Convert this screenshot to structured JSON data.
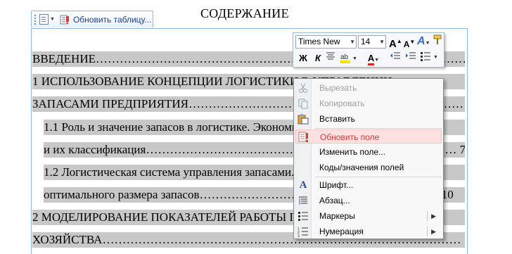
{
  "document": {
    "title": "СОДЕРЖАНИЕ",
    "update_table_label": "Обновить таблицу...",
    "toc_lines": [
      "ВВЕДЕНИЕ……………………………………………………………………………………. 6",
      "1 ИСПОЛЬЗОВАНИЕ КОНЦЕПЦИИ ЛОГИСТИКИ В УПРАВЛЕНИИ",
      "ЗАПАСАМИ ПРЕДПРИЯТИЯ……………………………………………………………… 7",
      "1.1 Роль и значение запасов в логистике. Экономическая сущность запасов",
      "и их классификация…………………………………………………………………… 7",
      "1.2 Логистическая система управления запасами. Определение",
      "оптимального размера запасов…………………………………………………… 10",
      "2 МОДЕЛИРОВАНИЕ ПОКАЗАТЕЛЕЙ РАБОТЫ ПРЕДПРИЯТИЯ",
      "ХОЗЯЙСТВА……………………………………………………………………………… 19"
    ]
  },
  "mini_toolbar": {
    "font_name": "Times New",
    "font_size": "14",
    "grow_font": "A",
    "shrink_font": "A",
    "bold": "Ж",
    "italic": "К",
    "font_color": "A",
    "style_letter": "A"
  },
  "context_menu": {
    "items": [
      {
        "label": "Вырезать",
        "icon": "scissors-icon",
        "disabled": true
      },
      {
        "label": "Копировать",
        "icon": "copy-icon",
        "disabled": true
      },
      {
        "label": "Вставить",
        "icon": "paste-icon",
        "disabled": false
      },
      {
        "label": "Обновить поле",
        "icon": "update-field-icon",
        "disabled": false,
        "hover": true
      },
      {
        "label": "Изменить поле...",
        "icon": "",
        "disabled": false
      },
      {
        "label": "Коды/значения полей",
        "icon": "",
        "disabled": false
      },
      {
        "label": "Шрифт...",
        "icon": "font-icon",
        "disabled": false
      },
      {
        "label": "Абзац...",
        "icon": "paragraph-icon",
        "disabled": false
      },
      {
        "label": "Маркеры",
        "icon": "bullets-icon",
        "disabled": false,
        "submenu": true
      },
      {
        "label": "Нумерация",
        "icon": "numbering-icon",
        "disabled": false,
        "submenu": true
      }
    ]
  },
  "colors": {
    "field_highlight": "#c8c8c8",
    "hover_text": "#d23a3a",
    "tab_text": "#15428b"
  }
}
